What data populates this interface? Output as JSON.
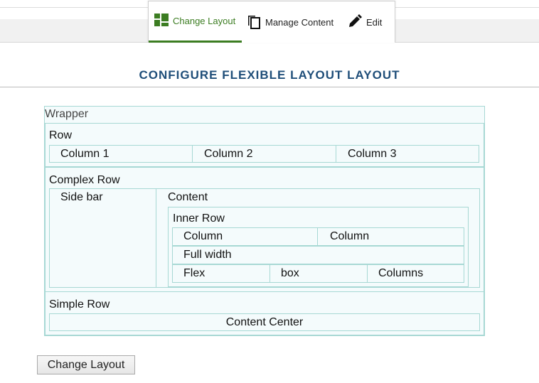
{
  "toolbar": {
    "tabs": [
      {
        "label": "Change Layout",
        "icon": "layout-grid-icon"
      },
      {
        "label": "Manage Content",
        "icon": "copy-pages-icon"
      },
      {
        "label": "Edit",
        "icon": "pencil-icon"
      }
    ],
    "active_color": "#3c7d22"
  },
  "page": {
    "title": "CONFIGURE FLEXIBLE LAYOUT LAYOUT",
    "title_color": "#1f4e79"
  },
  "layout": {
    "wrapper_label": "Wrapper",
    "row": {
      "label": "Row",
      "columns": [
        "Column 1",
        "Column 2",
        "Column 3"
      ]
    },
    "complex_row": {
      "label": "Complex Row",
      "sidebar": "Side bar",
      "content": "Content",
      "inner_row": {
        "label": "Inner Row",
        "columns": [
          "Column",
          "Column"
        ],
        "full_width": "Full width",
        "flex_cells": [
          "Flex",
          "box",
          "Columns"
        ]
      }
    },
    "simple_row": {
      "label": "Simple Row",
      "content_center": "Content Center"
    },
    "box_border_color": "#a7d8d4",
    "box_fill_color": "#f4fbfc"
  },
  "footer": {
    "change_layout_button": "Change Layout"
  }
}
